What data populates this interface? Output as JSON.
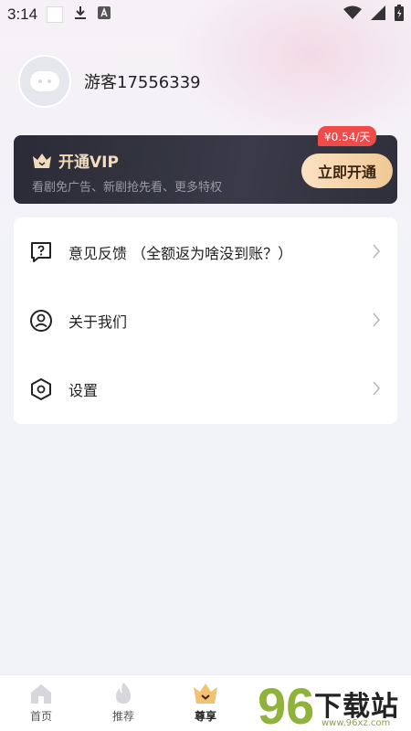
{
  "status_bar": {
    "time": "3:14"
  },
  "profile": {
    "username": "游客17556339"
  },
  "vip": {
    "title": "开通VIP",
    "description": "看剧免广告、新剧抢先看、更多特权",
    "button_label": "立即开通",
    "price_badge": "¥0.54/天",
    "accent_color": "#f3dcb9",
    "badge_color": "#ef4b4b"
  },
  "menu": {
    "items": [
      {
        "label": "意见反馈 （全额返为啥没到账？）",
        "icon": "feedback-icon"
      },
      {
        "label": "关于我们",
        "icon": "user-circle-icon"
      },
      {
        "label": "设置",
        "icon": "settings-hexagon-icon"
      }
    ]
  },
  "bottom_nav": {
    "items": [
      {
        "label": "首页",
        "icon": "home-icon",
        "active": false
      },
      {
        "label": "推荐",
        "icon": "flame-icon",
        "active": false
      },
      {
        "label": "尊享",
        "icon": "crown-icon",
        "active": true
      }
    ]
  },
  "watermark": {
    "digits": "96",
    "text": "下载站",
    "url": "www.96xz.com"
  }
}
